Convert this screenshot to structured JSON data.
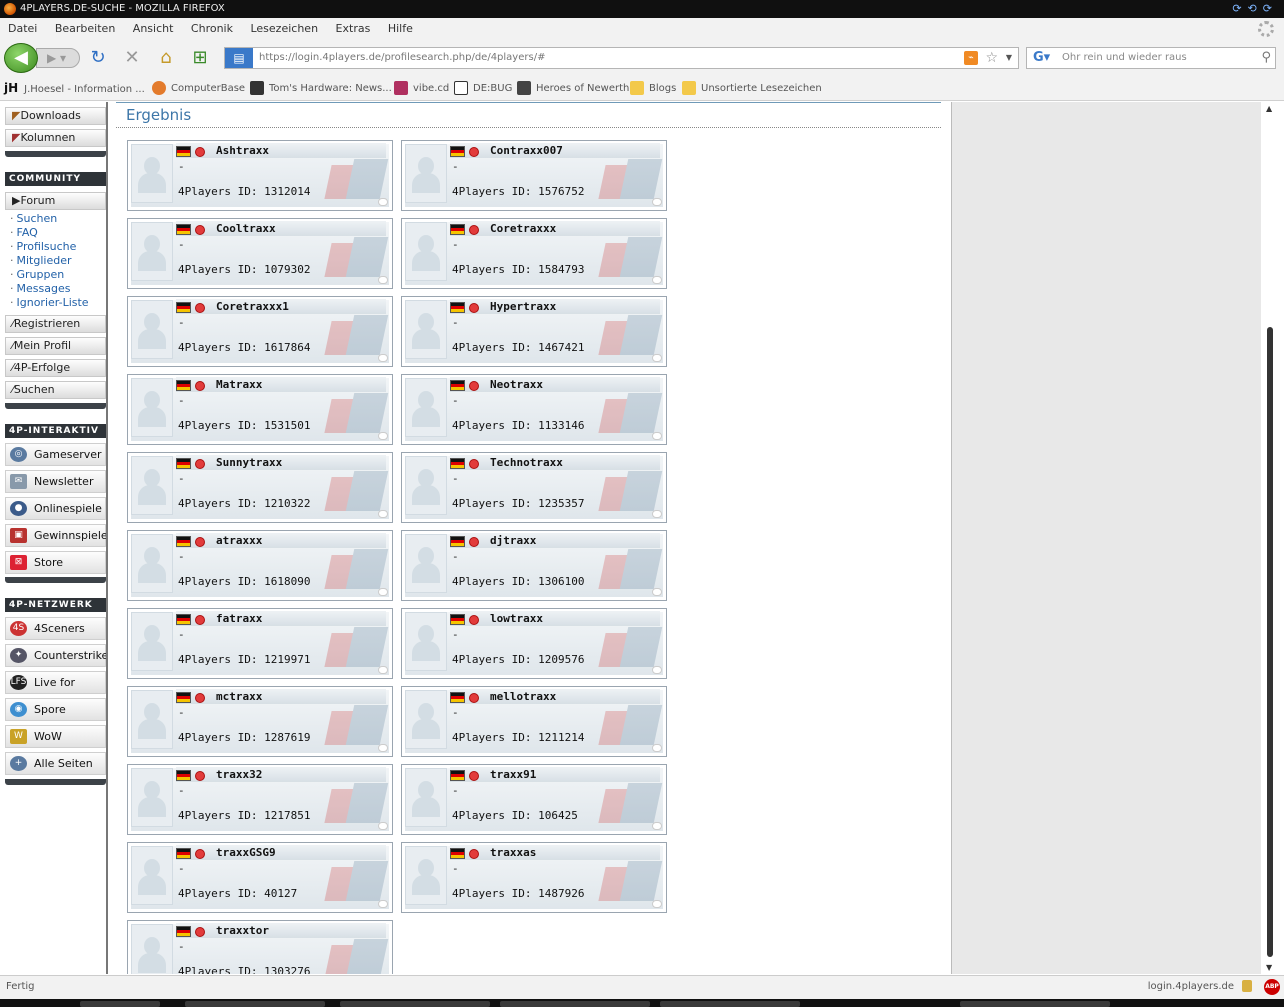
{
  "window": {
    "title": "4PLAYERS.DE-SUCHE - MOZILLA FIREFOX"
  },
  "menu": [
    "Datei",
    "Bearbeiten",
    "Ansicht",
    "Chronik",
    "Lesezeichen",
    "Extras",
    "Hilfe"
  ],
  "nav": {
    "url": "https://login.4players.de/profilesearch.php/de/4players/#",
    "search_placeholder": "Ohr rein und wieder raus"
  },
  "bookmarks": [
    "J.Hoesel - Information ...",
    "ComputerBase",
    "Tom's Hardware: News...",
    "vibe.cd",
    "DE:BUG",
    "Heroes of Newerth",
    "Blogs",
    "Unsortierte Lesezeichen"
  ],
  "sidebar": {
    "top_buttons": [
      "Downloads",
      "Kolumnen"
    ],
    "community_heading": "COMMUNITY",
    "forum_label": "Forum",
    "community_links": [
      "Suchen",
      "FAQ",
      "Profilsuche",
      "Mitglieder",
      "Gruppen",
      "Messages",
      "Ignorier-Liste"
    ],
    "account_buttons": [
      "Registrieren",
      "Mein Profil",
      "4P-Erfolge",
      "Suchen"
    ],
    "interaktiv_heading": "4P-INTERAKTIV",
    "interaktiv_items": [
      "Gameserver",
      "Newsletter",
      "Onlinespiele",
      "Gewinnspiele",
      "Store"
    ],
    "netzwerk_heading": "4P-NETZWERK",
    "netzwerk_items": [
      "4Sceners",
      "Counterstrike",
      "Live for Speed",
      "Spore",
      "WoW",
      "Alle Seiten"
    ]
  },
  "content": {
    "heading": "Ergebnis",
    "dash": "-",
    "id_prefix": "4Players ID: ",
    "results": [
      {
        "name": "Ashtraxx",
        "id": "1312014"
      },
      {
        "name": "Contraxx007",
        "id": "1576752"
      },
      {
        "name": "Cooltraxx",
        "id": "1079302"
      },
      {
        "name": "Coretraxxx",
        "id": "1584793"
      },
      {
        "name": "Coretraxxx1",
        "id": "1617864"
      },
      {
        "name": "Hypertraxx",
        "id": "1467421"
      },
      {
        "name": "Matraxx",
        "id": "1531501"
      },
      {
        "name": "Neotraxx",
        "id": "1133146"
      },
      {
        "name": "Sunnytraxx",
        "id": "1210322"
      },
      {
        "name": "Technotraxx",
        "id": "1235357"
      },
      {
        "name": "atraxxx",
        "id": "1618090"
      },
      {
        "name": "djtraxx",
        "id": "1306100"
      },
      {
        "name": "fatraxx",
        "id": "1219971"
      },
      {
        "name": "lowtraxx",
        "id": "1209576"
      },
      {
        "name": "mctraxx",
        "id": "1287619"
      },
      {
        "name": "mellotraxx",
        "id": "1211214"
      },
      {
        "name": "traxx32",
        "id": "1217851"
      },
      {
        "name": "traxx91",
        "id": "106425"
      },
      {
        "name": "traxxGSG9",
        "id": "40127"
      },
      {
        "name": "traxxas",
        "id": "1487926"
      },
      {
        "name": "traxxtor",
        "id": "1303276"
      }
    ]
  },
  "status": {
    "left": "Fertig",
    "domain": "login.4players.de",
    "abp": "ABP"
  },
  "colors": {
    "accent": "#3d76a8",
    "online": "#e23b3b",
    "sidebar_heading": "#2e3338"
  }
}
